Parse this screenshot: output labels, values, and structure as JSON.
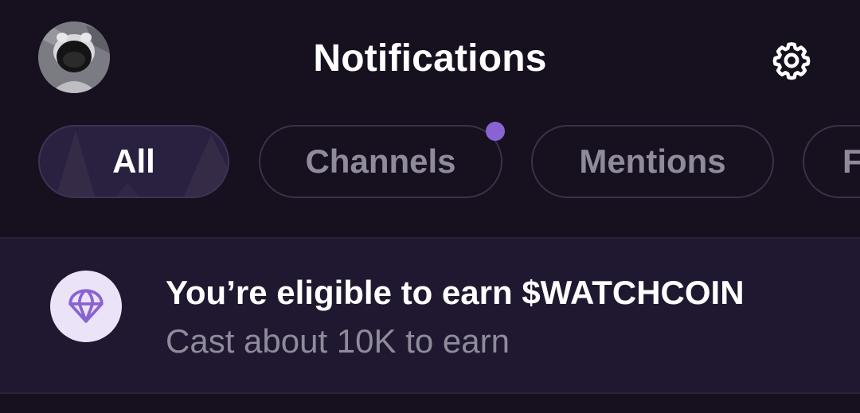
{
  "header": {
    "title": "Notifications",
    "avatar_icon": "user-avatar",
    "settings_icon": "gear-icon"
  },
  "tabs": [
    {
      "label": "All",
      "active": true
    },
    {
      "label": "Channels",
      "active": false,
      "has_unread_dot": true
    },
    {
      "label": "Mentions",
      "active": false
    },
    {
      "label": "F",
      "active": false
    }
  ],
  "notice": {
    "icon": "parachute-icon",
    "title": "You’re eligible to earn $WATCHCOIN",
    "subtitle": "Cast about 10K to earn"
  },
  "colors": {
    "background": "#17101f",
    "notice_background": "#201830",
    "accent_purple": "#8a63d2",
    "active_tab": "#2a2040",
    "muted_text": "#8f8b9a"
  }
}
